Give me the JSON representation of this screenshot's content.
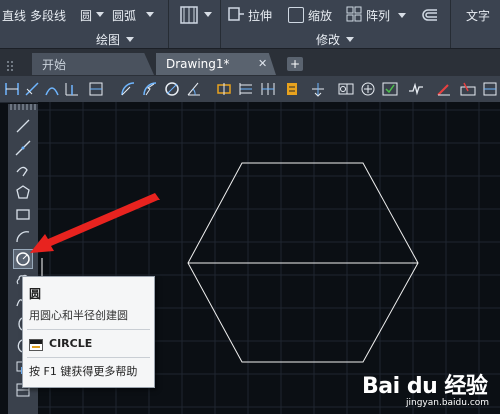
{
  "ribbon": {
    "top_labels": [
      "直线",
      "多段线",
      "圆",
      "圆弧"
    ],
    "modify_buttons": {
      "stretch": "拉伸",
      "scale": "缩放",
      "array": "阵列"
    },
    "groups": {
      "draw": "绘图",
      "modify": "修改"
    },
    "right_label": "文字"
  },
  "tabs": {
    "start": "开始",
    "drawing": "Drawing1*"
  },
  "tooltip": {
    "title": "圆",
    "description": "用圆心和半径创建圆",
    "command": "CIRCLE",
    "help": "按 F1 键获得更多帮助"
  },
  "watermark": {
    "brand": "Bai du 经验",
    "url": "jingyan.baidu.com"
  },
  "colors": {
    "canvas_bg": "#0b0f14",
    "ribbon_bg": "#3b4350",
    "arrow": "#e8231f",
    "hexagon_stroke": "#f0f0f0",
    "grid": "#1f2630"
  },
  "icons": {
    "left_toolbar": [
      "line-icon",
      "construction-line-icon",
      "polyline-icon",
      "polygon-icon",
      "rectangle-icon",
      "arc-icon",
      "circle-icon",
      "revision-cloud-icon",
      "spline-icon",
      "ellipse-icon",
      "ellipse-arc-icon",
      "insert-block-icon"
    ]
  }
}
